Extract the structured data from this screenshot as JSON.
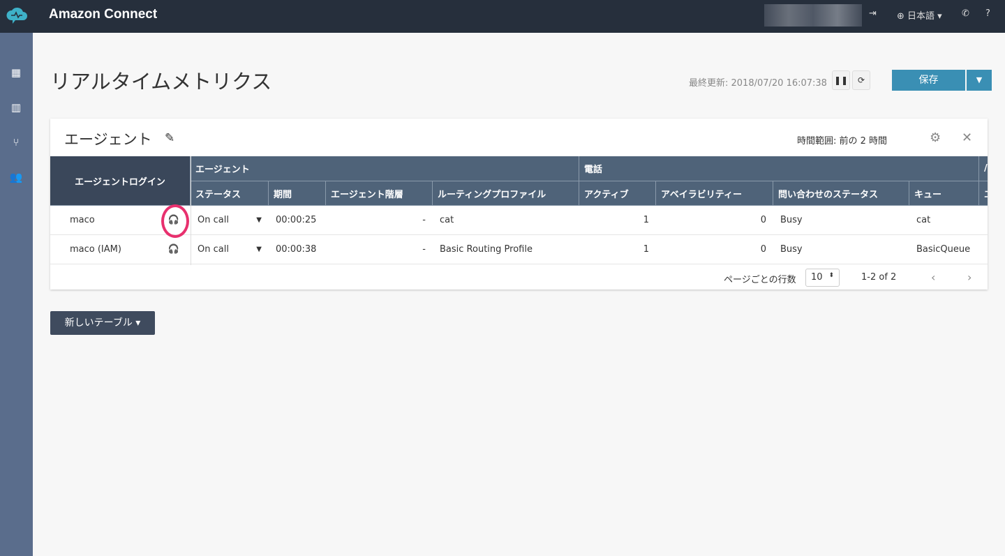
{
  "header": {
    "brand": "Amazon Connect",
    "language": "日本語 ▾",
    "help": "?"
  },
  "page": {
    "title": "リアルタイムメトリクス",
    "last_updated": "最終更新: 2018/07/20 16:07:38",
    "save_label": "保存"
  },
  "card": {
    "title": "エージェント",
    "time_range": "時間範囲: 前の 2 時間"
  },
  "table": {
    "login_header": "エージェントログイン",
    "groups": [
      "エージェント",
      "電話",
      "/"
    ],
    "columns": [
      "ステータス",
      "期間",
      "エージェント階層",
      "ルーティングプロファイル",
      "アクティブ",
      "アベイラビリティー",
      "問い合わせのステータス",
      "キュー",
      "エ"
    ],
    "rows": [
      {
        "login": "maco",
        "status": "On call",
        "duration": "00:00:25",
        "hierarchy": "-",
        "profile": "cat",
        "active": "1",
        "availability": "0",
        "contact_status": "Busy",
        "queue": "cat"
      },
      {
        "login": "maco (IAM)",
        "status": "On call",
        "duration": "00:00:38",
        "hierarchy": "-",
        "profile": "Basic Routing Profile",
        "active": "1",
        "availability": "0",
        "contact_status": "Busy",
        "queue": "BasicQueue"
      }
    ],
    "rows_per_page_label": "ページごとの行数",
    "rows_per_page": "10",
    "range": "1-2 of 2"
  },
  "new_table_label": "新しいテーブル ▾"
}
